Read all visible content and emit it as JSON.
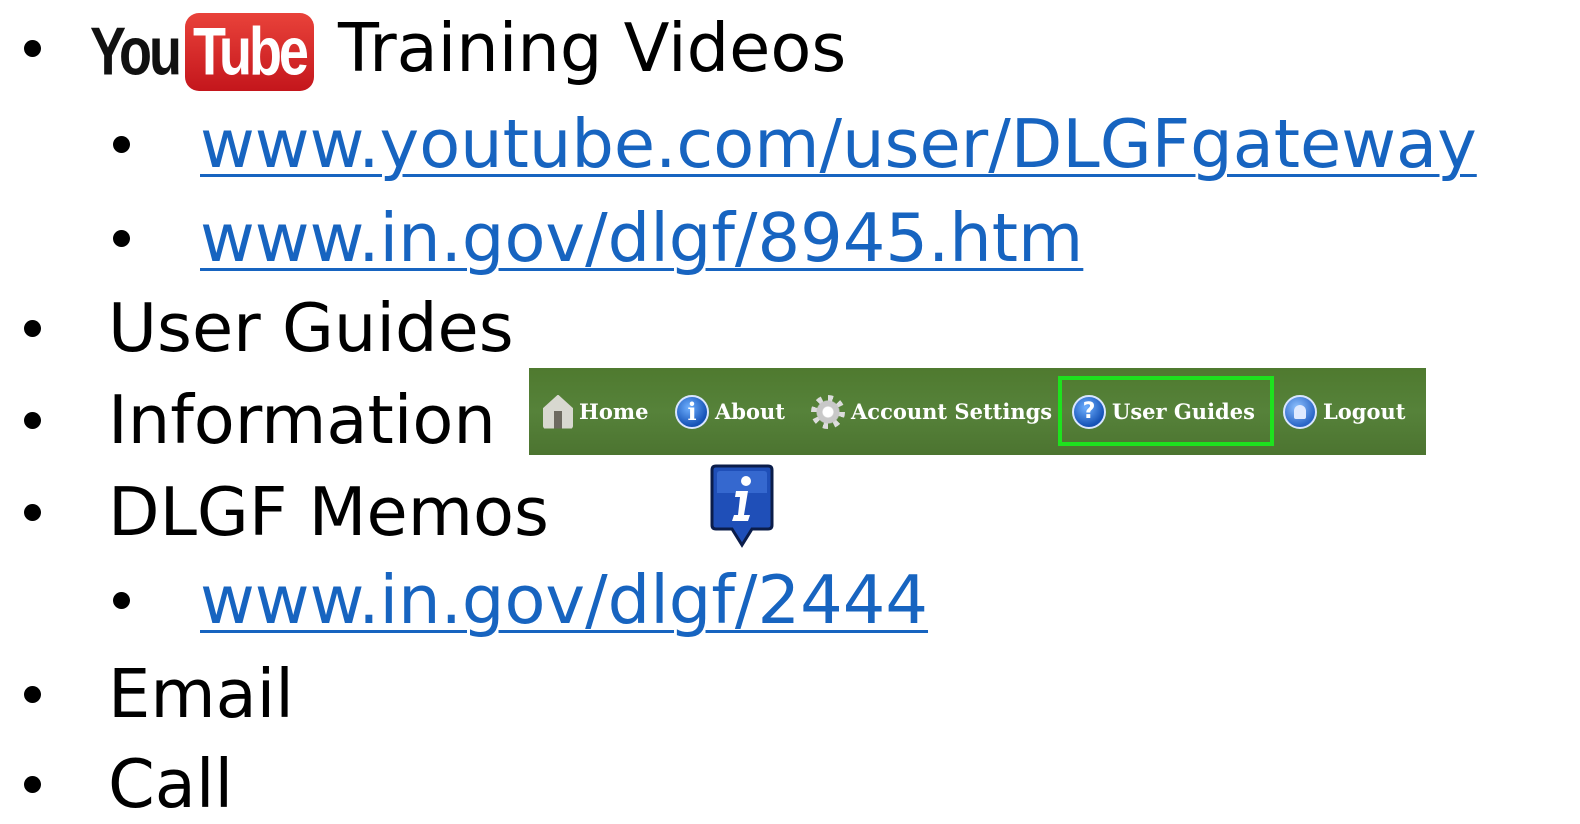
{
  "items": [
    {
      "label": "Training Videos"
    },
    {
      "label": "www.youtube.com/user/DLGFgateway"
    },
    {
      "label": "www.in.gov/dlgf/8945.htm"
    },
    {
      "label": "User Guides"
    },
    {
      "label": "Information"
    },
    {
      "label": "DLGF Memos"
    },
    {
      "label": "www.in.gov/dlgf/2444"
    },
    {
      "label": "Email"
    },
    {
      "label": "Call"
    }
  ],
  "logo": {
    "name": "youtube-logo",
    "you": "You",
    "tube": "Tube",
    "colors": {
      "red": "#d7262b",
      "dark": "#111111"
    }
  },
  "navbar": {
    "items": [
      {
        "label": "Home",
        "icon": "home-icon"
      },
      {
        "label": "About",
        "icon": "info-icon"
      },
      {
        "label": "Account Settings",
        "icon": "gear-icon"
      },
      {
        "label": "User Guides",
        "icon": "help-icon",
        "highlighted": true
      },
      {
        "label": "Logout",
        "icon": "user-icon"
      }
    ],
    "colors": {
      "background": "#527d34",
      "highlight_border": "#1ee21e",
      "text": "#ffffff"
    }
  },
  "marker": {
    "icon": "info-marker-icon",
    "color": "#1f4fb8"
  },
  "colors": {
    "link": "#1764c0",
    "text": "#000000"
  }
}
